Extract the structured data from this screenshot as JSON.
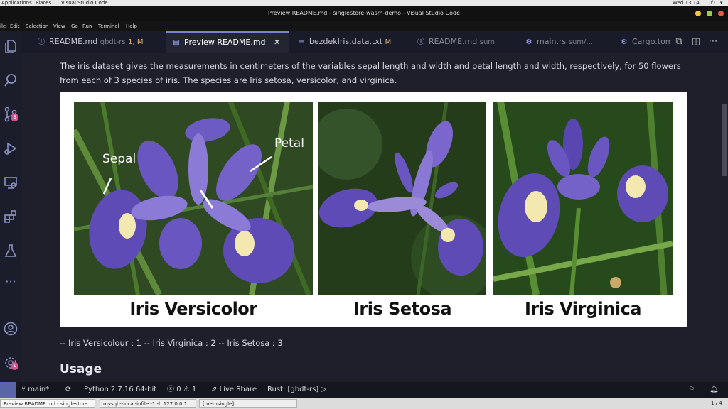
{
  "system_bar": {
    "applications": "Applications",
    "places": "Places",
    "app": "Visual Studio Code",
    "clock": "Wed 13:14"
  },
  "window": {
    "title": "Preview README.md - singlestore-wasm-demo - Visual Studio Code"
  },
  "menu": {
    "file": "ile",
    "edit": "Edit",
    "selection": "Selection",
    "view": "View",
    "go": "Go",
    "run": "Run",
    "terminal": "Terminal",
    "help": "Help"
  },
  "activity": {
    "scm_badge": "3",
    "settings_badge": "1"
  },
  "tabs": [
    {
      "label": "README.md",
      "detail": "gbdt-rs",
      "mod": "1, M",
      "icon": "info-icon"
    },
    {
      "label": "Preview README.md",
      "icon": "preview-icon",
      "close": "✕"
    },
    {
      "label": "bezdekIris.data.txt",
      "mod": "M",
      "icon": "lines-icon"
    },
    {
      "label": "README.md",
      "detail": "sum",
      "icon": "info-icon"
    },
    {
      "label": "main.rs",
      "detail": "sum/...",
      "icon": "rust-icon"
    },
    {
      "label": "Cargo.tom",
      "icon": "gear-icon"
    }
  ],
  "content": {
    "intro": "The iris dataset gives the measurements in centimeters of the variables sepal length and width and petal length and width, respectively, for 50 flowers from each of 3 species of iris. The species are Iris setosa, versicolor, and virginica.",
    "figure": {
      "sepal_label": "Sepal",
      "petal_label": "Petal",
      "captions": [
        "Iris Versicolor",
        "Iris Setosa",
        "Iris Virginica"
      ]
    },
    "mapping": "-- Iris Versicolour : 1 -- Iris Virginica : 2 -- Iris Setosa : 3",
    "usage_heading": "Usage"
  },
  "status": {
    "branch": "main*",
    "python": "Python 2.7.16 64-bit",
    "errors": "0",
    "warnings": "1",
    "live_share": "Live Share",
    "rust": "Rust: [gbdt-rs]"
  },
  "taskbar": {
    "items": [
      "Preview README.md - singlestore...",
      "mysql --local-infile -1 -h 127.0.0.1...",
      "[memsingle]"
    ],
    "pager": "1 / 4"
  },
  "colors": {
    "accent": "#7a84c8",
    "badge": "#d94f8a",
    "editor_bg": "#1e1f2b",
    "iris_purple": "#6a56c0"
  }
}
